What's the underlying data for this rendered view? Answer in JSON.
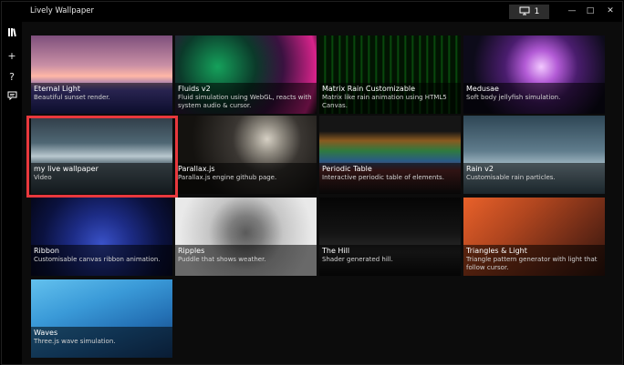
{
  "window": {
    "title": "Lively Wallpaper",
    "monitor_count": "1"
  },
  "nav_icons": [
    "library-icon",
    "add-icon",
    "help-icon",
    "feedback-icon"
  ],
  "selected_index": 4,
  "tiles": [
    {
      "title": "Eternal Light",
      "desc": "Beautiful sunset render."
    },
    {
      "title": "Fluids v2",
      "desc": "Fluid simulation using WebGL, reacts with system audio & cursor."
    },
    {
      "title": "Matrix Rain Customizable",
      "desc": "Matrix like rain animation using HTML5 Canvas."
    },
    {
      "title": "Medusae",
      "desc": "Soft body jellyfish simulation."
    },
    {
      "title": "my live wallpaper",
      "desc": "Video"
    },
    {
      "title": "Parallax.js",
      "desc": "Parallax.js engine github page."
    },
    {
      "title": "Periodic Table",
      "desc": "Interactive periodic table of elements."
    },
    {
      "title": "Rain v2",
      "desc": "Customisable rain particles."
    },
    {
      "title": "Ribbon",
      "desc": "Customisable canvas ribbon animation."
    },
    {
      "title": "Ripples",
      "desc": "Puddle that shows weather."
    },
    {
      "title": "The Hill",
      "desc": "Shader generated hill."
    },
    {
      "title": "Triangles & Light",
      "desc": "Triangle pattern generator with light that follow cursor."
    },
    {
      "title": "Waves",
      "desc": "Three.js wave simulation."
    }
  ]
}
